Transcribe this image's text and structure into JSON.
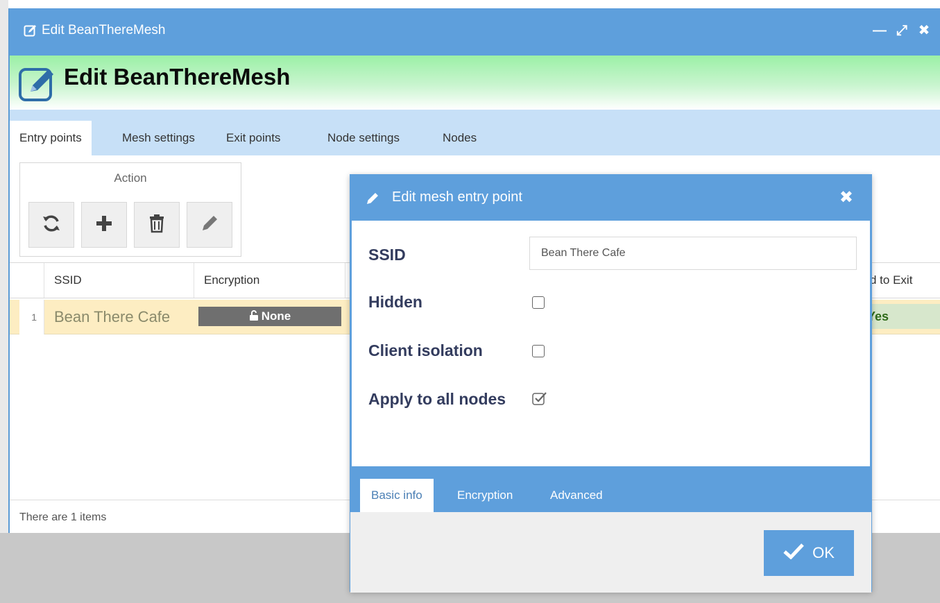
{
  "window": {
    "title": "Edit BeanThereMesh",
    "minimize_glyph": "—",
    "maximize_glyph": "⤢",
    "close_glyph": "✖"
  },
  "page_header": {
    "title": "Edit BeanThereMesh"
  },
  "tabs": [
    {
      "label": "Entry points",
      "active": true
    },
    {
      "label": "Mesh settings",
      "active": false
    },
    {
      "label": "Exit points",
      "active": false
    },
    {
      "label": "Node settings",
      "active": false
    },
    {
      "label": "Nodes",
      "active": false
    }
  ],
  "toolbar": {
    "title": "Action",
    "buttons": [
      {
        "icon": "refresh-icon"
      },
      {
        "icon": "plus-icon"
      },
      {
        "icon": "trash-icon"
      },
      {
        "icon": "pencil-icon"
      }
    ]
  },
  "grid": {
    "columns": [
      "SSID",
      "Encryption",
      "d to Exit"
    ],
    "rows": [
      {
        "num": "1",
        "ssid": "Bean There Cafe",
        "encryption": "None",
        "exit": "Yes"
      }
    ],
    "footer": "There are 1 items"
  },
  "dialog": {
    "title": "Edit mesh entry point",
    "close_glyph": "✖",
    "fields": {
      "ssid_label": "SSID",
      "ssid_value": "Bean There Cafe",
      "hidden_label": "Hidden",
      "hidden_checked": false,
      "client_isolation_label": "Client isolation",
      "client_isolation_checked": false,
      "apply_all_label": "Apply to all nodes",
      "apply_all_checked": true
    },
    "tabs": [
      {
        "label": "Basic info",
        "active": true
      },
      {
        "label": "Encryption",
        "active": false
      },
      {
        "label": "Advanced",
        "active": false
      }
    ],
    "ok_label": "OK"
  },
  "colors": {
    "titlebar": "#5e9fdc",
    "tabbar": "#c7e0f7",
    "selected_row": "#fdedc2",
    "badge_none": "#6f6f6f",
    "badge_yes": "#d7e7cc"
  }
}
